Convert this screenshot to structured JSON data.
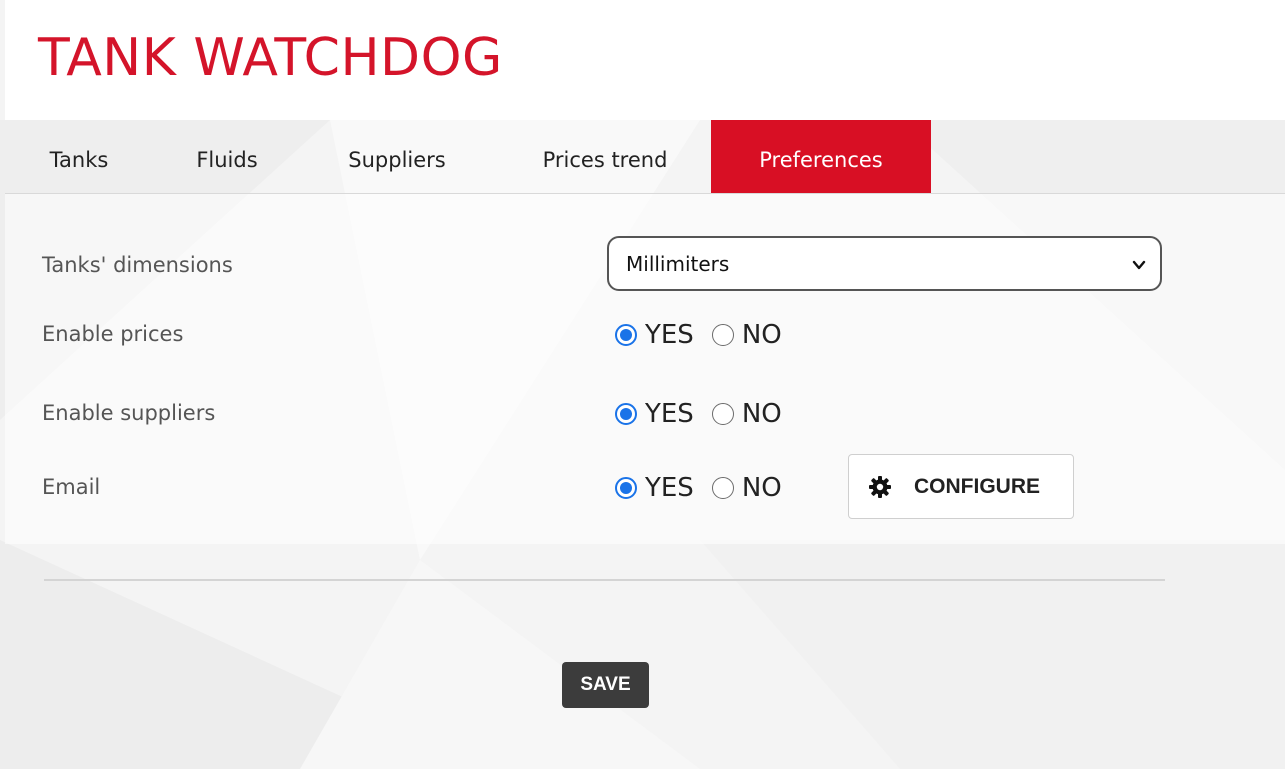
{
  "app": {
    "title": "TANK WATCHDOG",
    "accent_color": "#d80f24"
  },
  "nav": {
    "tabs": [
      {
        "label": "Tanks",
        "active": false
      },
      {
        "label": "Fluids",
        "active": false
      },
      {
        "label": "Suppliers",
        "active": false
      },
      {
        "label": "Prices trend",
        "active": false
      },
      {
        "label": "Preferences",
        "active": true
      }
    ]
  },
  "preferences": {
    "dimensions": {
      "label": "Tanks' dimensions",
      "selected": "Millimiters"
    },
    "prices": {
      "label": "Enable prices",
      "yes_label": "YES",
      "no_label": "NO",
      "value": "YES"
    },
    "suppliers": {
      "label": "Enable suppliers",
      "yes_label": "YES",
      "no_label": "NO",
      "value": "YES"
    },
    "email": {
      "label": "Email",
      "yes_label": "YES",
      "no_label": "NO",
      "value": "YES",
      "configure_label": "CONFIGURE",
      "configure_icon": "gear-icon"
    }
  },
  "actions": {
    "save_label": "SAVE"
  }
}
